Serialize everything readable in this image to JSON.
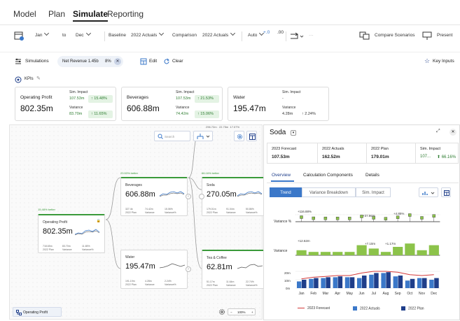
{
  "nav": {
    "tabs": [
      "Model",
      "Plan",
      "Simulate",
      "Reporting"
    ],
    "active": "Simulate"
  },
  "toolbar": {
    "from": "Jan",
    "to_label": "to",
    "to": "Dec",
    "baseline_label": "Baseline",
    "baseline": "2022 Actuals",
    "comparison_label": "Comparison",
    "comparison": "2022 Actuals",
    "auto": "Auto",
    "dec_plus": "+.0",
    "dec_val": ".00",
    "compare_scenarios": "Compare Scenarios",
    "present": "Present"
  },
  "simbar": {
    "simulations": "Simulations",
    "pill_label": "Net Revenue 1.45b",
    "pill_pct": "8%",
    "edit": "Edit",
    "clear": "Clear",
    "key_inputs": "Key Inputs"
  },
  "kpis": {
    "header": "KPIs",
    "cards": [
      {
        "name": "Operating Profit",
        "value": "802.35m",
        "sim_label": "Sim. Impact",
        "sim_value": "107.53m",
        "sim_pct": "15.48%",
        "var_label": "Variance",
        "var_value": "83.70m",
        "var_pct": "11.65%"
      },
      {
        "name": "Beverages",
        "value": "606.88m",
        "sim_label": "Sim. Impact",
        "sim_value": "107.53m",
        "sim_pct": "21.53%",
        "var_label": "Variance",
        "var_value": "74.42m",
        "var_pct": "15.06%"
      },
      {
        "name": "Water",
        "value": "195.47m",
        "sim_label": "Sim. Impact",
        "sim_value": "-",
        "var_label": "Variance",
        "var_value": "4.28m",
        "var_pct": "2.24%"
      }
    ]
  },
  "canvas": {
    "search_placeholder": "Search",
    "chip": "296.72m",
    "chip2": "22.75m",
    "chip3": "17.07%",
    "footer": "Operating Profit",
    "zoom": "100%",
    "nodes": [
      {
        "title": "Operating Profit",
        "value": "802.35m",
        "better": "15.48% better",
        "m1": "718.65m",
        "m1l": "2022 Plan",
        "m2": "83.70m",
        "m2l": "Variance",
        "m3": "11.65%",
        "m3l": "Variance%"
      },
      {
        "title": "Beverages",
        "value": "606.88m",
        "better": "23.53% better",
        "m1": "327.4k",
        "m1l": "2022 Plan",
        "m2": "74.42m",
        "m2l": "Variance",
        "m3": "15.06%",
        "m3l": "Variance%"
      },
      {
        "title": "Water",
        "value": "195.47m",
        "better": "",
        "m1": "191.19m",
        "m1l": "2022 Plan",
        "m2": "4.28m",
        "m2l": "Variance",
        "m3": "2.24%",
        "m3l": "Variance%"
      },
      {
        "title": "Soda",
        "value": "270.05m",
        "better": "66.16% better",
        "m1": "179.01m",
        "m1l": "2022 Plan",
        "m2": "91.04m",
        "m2l": "Variance",
        "m3": "50.86%",
        "m3l": "Variance%"
      },
      {
        "title": "Tea & Coffee",
        "value": "62.81m",
        "better": "",
        "m1": "51.17m",
        "m1l": "2022 Plan",
        "m2": "11.64m",
        "m2l": "Variance",
        "m3": "22.74%",
        "m3l": "Variance%"
      }
    ]
  },
  "panel": {
    "title": "Soda",
    "stats": [
      {
        "label": "2023 Forecast",
        "value": "107.53m"
      },
      {
        "label": "2022 Actuals",
        "value": "162.52m"
      },
      {
        "label": "2022 Plan",
        "value": "179.01m"
      },
      {
        "label": "Sim. Impact",
        "value": "107...",
        "pct": "66.16%"
      }
    ],
    "tabs": [
      "Overview",
      "Calculation Components",
      "Details"
    ],
    "segs": [
      "Trend",
      "Variance Breakdown",
      "Sim. Impact"
    ],
    "row1": "Variance %",
    "row2": "Variance",
    "ann": [
      "+116.88%",
      "+37.86%",
      "+4.85%",
      "+12.62m",
      "+7.10m",
      "+1.17m"
    ],
    "yticks": [
      "20m",
      "10m",
      "0m"
    ],
    "legend": [
      "2023 Forecast",
      "2022 Actuals",
      "2022 Plan"
    ]
  },
  "chart_data": {
    "type": "bar",
    "categories": [
      "Jan",
      "Feb",
      "Mar",
      "Apr",
      "May",
      "Jun",
      "Jul",
      "Aug",
      "Sep",
      "Oct",
      "Nov",
      "Dec"
    ],
    "series": [
      {
        "name": "2023 Forecast",
        "type": "line",
        "values": [
          11,
          13,
          14,
          15,
          15,
          18,
          20,
          20,
          19,
          16,
          15,
          16
        ]
      },
      {
        "name": "2022 Actuals",
        "values": [
          8,
          11,
          12,
          13,
          13,
          12,
          16,
          18,
          14,
          9,
          12,
          10
        ]
      },
      {
        "name": "2022 Plan",
        "values": [
          10,
          12,
          13,
          14,
          13,
          15,
          18,
          19,
          15,
          11,
          12,
          12
        ]
      }
    ],
    "ylim": [
      0,
      20
    ],
    "colors": {
      "forecast": "#d33a3a",
      "actuals": "#3b78c9",
      "plan": "#1f3e8a",
      "variance": "#8cc34a"
    }
  }
}
